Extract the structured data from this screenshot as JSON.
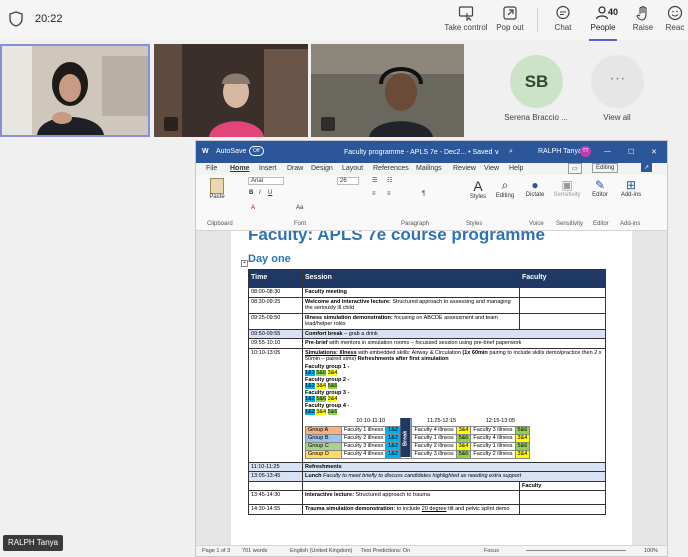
{
  "topbar": {
    "time": "20:22",
    "buttons": [
      {
        "id": "take-control",
        "label": "Take control",
        "icon": "take-control-icon"
      },
      {
        "id": "pop-out",
        "label": "Pop out",
        "icon": "pop-out-icon"
      },
      {
        "id": "chat",
        "label": "Chat",
        "icon": "chat-icon"
      },
      {
        "id": "people",
        "label": "People",
        "icon": "people-icon",
        "count": "40"
      },
      {
        "id": "raise",
        "label": "Raise",
        "icon": "hand-icon"
      },
      {
        "id": "react",
        "label": "Reac",
        "icon": "smile-icon"
      }
    ]
  },
  "participants": {
    "sb_initials": "SB",
    "sb_name": "Serena Braccio ...",
    "view_all_label": "View all",
    "view_all_glyph": "···"
  },
  "word": {
    "autosave": "AutoSave",
    "autosave_state": "Off",
    "doc_title": "Faculty programme - APLS 7e - Dec2... • Saved ∨",
    "user": "RALPH Tanya",
    "user_initials": "TT",
    "menu": [
      "File",
      "Home",
      "Insert",
      "Draw",
      "Design",
      "Layout",
      "References",
      "Mailings",
      "Review",
      "View",
      "Help"
    ],
    "editing_label": "Editing",
    "ribbon": {
      "font_name": "Arial",
      "font_size": "26",
      "paste": "Paste",
      "clipboard": "Clipboard",
      "font": "Font",
      "paragraph": "Paragraph",
      "styles": "Styles",
      "editing": "Editing",
      "dictate": "Dictate",
      "sensitivity": "Sensitivity",
      "editor": "Editor",
      "addins": "Add-ins",
      "voice": "Voice"
    },
    "doc": {
      "heading": "Faculty: APLS 7e course programme",
      "subheading": "Day one",
      "headers": {
        "time": "Time",
        "session": "Session",
        "faculty": "Faculty"
      },
      "rows": [
        {
          "time": "08:00-08:30",
          "b": "Faculty meeting",
          "rest": ""
        },
        {
          "time": "08:30-09:25",
          "b": "Welcome and interactive lecture:",
          "rest": " Structured approach to assessing and managing the seriously ill child"
        },
        {
          "time": "09:25-09:50",
          "b": "Illness simulation demonstration:",
          "rest": " focusing on ABCDE assessment and team lead/helper roles"
        },
        {
          "time": "09:50-09:55",
          "b": "Comfort break",
          "rest": " – grab a drink"
        },
        {
          "time": "09:55-10:10",
          "b": "Pre-brief",
          "rest": " with mentors in simulation rooms – focussed session using pre-brief paperwork"
        }
      ],
      "sim": {
        "time": "10:10-13:05",
        "title": "Simulations: Illness",
        "text": " with embedded skills: Airway & Circulation ",
        "bold2": "(1x 60min",
        "text2": " pairing to include skills demo/practice then 2 x 50min – paired sims) ",
        "bold3": "Refreshments after first simulation",
        "groups": [
          {
            "label": "Faculty group 1 -",
            "pairs": [
              "1&2",
              "5&6",
              "3&4"
            ]
          },
          {
            "label": "Faculty group 2 -",
            "pairs": [
              "1&2",
              "3&4",
              "5&6"
            ]
          },
          {
            "label": "Faculty group 3 -",
            "pairs": [
              "1&2",
              "5&6",
              "3&4"
            ]
          },
          {
            "label": "Faculty group 4 -",
            "pairs": [
              "1&2",
              "3&4",
              "5&6"
            ]
          }
        ],
        "slots": [
          "10:10-11:10",
          "11:25-12:15",
          "12:15-13:05"
        ],
        "break_label": "Break",
        "grid": [
          {
            "g": "Group A",
            "c1": "Faculty 1 illness",
            "p1": "1&2",
            "c2": "Faculty 4 illness",
            "p2": "3&4",
            "c3": "Faculty 3 illness",
            "p3": "5&6"
          },
          {
            "g": "Group B",
            "c1": "Faculty 2 illness",
            "p1": "1&2",
            "c2": "Faculty 1 illness",
            "p2": "5&6",
            "c3": "Faculty 4 illness",
            "p3": "3&4"
          },
          {
            "g": "Group C",
            "c1": "Faculty 3 illness",
            "p1": "1&2",
            "c2": "Faculty 2 illness",
            "p2": "3&4",
            "c3": "Faculty 1 illness",
            "p3": "5&6"
          },
          {
            "g": "Group D",
            "c1": "Faculty 4 illness",
            "p1": "1&2",
            "c2": "Faculty 3 illness",
            "p2": "5&6",
            "c3": "Faculty 2 illness",
            "p3": "3&4"
          }
        ]
      },
      "refresh": {
        "time": "11:10-11:25",
        "b": "Refreshments"
      },
      "lunch": {
        "time": "13:05-13:45",
        "b": "Lunch",
        "rest": " Faculty to meet briefly to discuss candidates highlighted as needing extra support"
      },
      "faculty_label": "Faculty",
      "lecture": {
        "time": "13:45-14:30",
        "b": "Interactive lecture:",
        "rest": " Structured approach to trauma"
      },
      "trauma": {
        "time": "14:30-14:55",
        "b": "Trauma simulation demonstration:",
        "rest": " to include ",
        "u": "20 degree",
        "rest2": " tilt and pelvic splint demo"
      }
    },
    "status": {
      "page": "Page 1 of 3",
      "words": "701 words",
      "lang": "English (United Kingdom)",
      "predict": "Text Predictions: On",
      "focus": "Focus",
      "zoom": "100%"
    }
  },
  "presenter_name": "RALPH Tanya",
  "colors": {
    "accent": "#5b5fc7",
    "word_blue": "#2b579a",
    "heading": "#2e74b5",
    "table_header": "#1f3864"
  }
}
